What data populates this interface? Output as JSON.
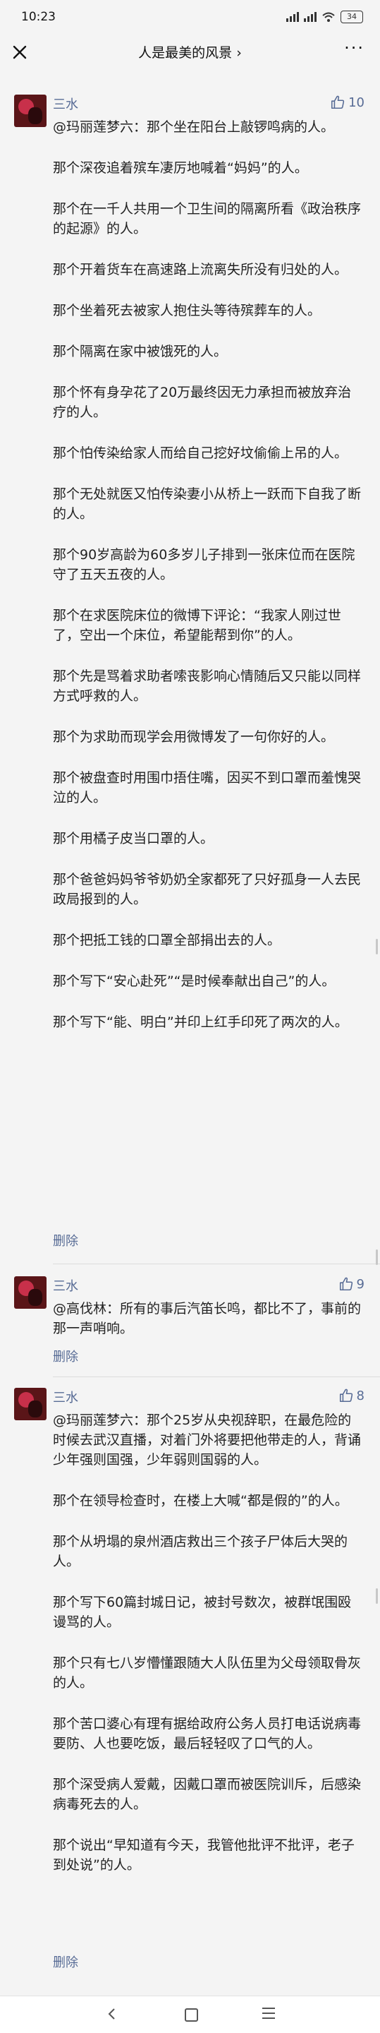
{
  "status": {
    "time": "10:23",
    "battery": "34"
  },
  "nav": {
    "title": "人是最美的风景 ›"
  },
  "comments": [
    {
      "author": "三水",
      "likes": "10",
      "paragraphs": [
        "@玛丽莲梦六：那个坐在阳台上敲锣鸣病的人。",
        "那个深夜追着殡车凄厉地喊着“妈妈”的人。",
        "那个在一千人共用一个卫生间的隔离所看《政治秩序的起源》的人。",
        "那个开着货车在高速路上流离失所没有归处的人。",
        "那个坐着死去被家人抱住头等待殡葬车的人。",
        "那个隔离在家中被饿死的人。",
        "那个怀有身孕花了20万最终因无力承担而被放弃治疗的人。",
        "那个怕传染给家人而给自己挖好坟偷偷上吊的人。",
        "那个无处就医又怕传染妻小从桥上一跃而下自我了断的人。",
        "那个90岁高龄为60多岁儿子排到一张床位而在医院守了五天五夜的人。",
        "那个在求医院床位的微博下评论：“我家人刚过世了，空出一个床位，希望能帮到你”的人。",
        "那个先是骂着求助者嗦丧影响心情随后又只能以同样方式呼救的人。",
        "那个为求助而现学会用微博发了一句你好的人。",
        "那个被盘查时用围巾捂住嘴，因买不到口罩而羞愧哭泣的人。",
        "那个用橘子皮当口罩的人。",
        "那个爸爸妈妈爷爷奶奶全家都死了只好孤身一人去民政局报到的人。",
        "那个把抵工钱的口罩全部捐出去的人。",
        "那个写下“安心赴死”“是时候奉献出自己”的人。",
        "那个写下“能、明白”并印上红手印死了两次的人。"
      ],
      "delete_label": "删除"
    },
    {
      "author": "三水",
      "likes": "9",
      "paragraphs": [
        "@高伐林：所有的事后汽笛长鸣，都比不了，事前的那一声哨响。"
      ],
      "delete_label": "删除"
    },
    {
      "author": "三水",
      "likes": "8",
      "paragraphs": [
        "@玛丽莲梦六：那个25岁从央视辞职，在最危险的时候去武汉直播，对着门外将要把他带走的人，背诵少年强则国强，少年弱则国弱的人。",
        "那个在领导检查时，在楼上大喊“都是假的”的人。",
        "那个从坍塌的泉州酒店救出三个孩子尸体后大哭的人。",
        "那个写下60篇封城日记，被封号数次，被群氓围殴谩骂的人。",
        "那个只有七八岁懵懂跟随大人队伍里为父母领取骨灰的人。",
        "那个苦口婆心有理有据给政府公务人员打电话说病毒要防、人也要吃饭，最后轻轻叹了口气的人。",
        "那个深受病人爱戴，因戴口罩而被医院训斥，后感染病毒死去的人。",
        "那个说出“早知道有今天，我管他批评不批评，老子到处说”的人。"
      ],
      "delete_label": "删除"
    }
  ],
  "icons": {
    "close": "close-icon",
    "more": "more-icon",
    "thumb": "thumb-up-icon",
    "back": "back-icon",
    "home": "home-icon",
    "menu": "menu-icon"
  },
  "colors": {
    "link": "#576b95",
    "background": "#f4f4f4",
    "text": "#222222"
  }
}
